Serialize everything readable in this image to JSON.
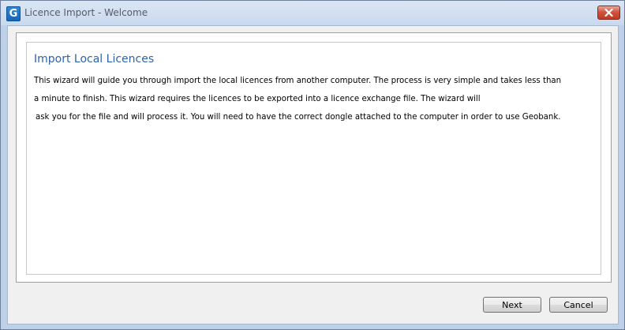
{
  "window": {
    "title": "Licence Import - Welcome",
    "app_icon_letter": "G"
  },
  "content": {
    "heading": "Import Local Licences",
    "description_lines": [
      "This wizard will guide you through import the local licences from another computer. The process is very simple and takes less than",
      "a minute to finish. This wizard requires the licences to be exported into a licence exchange file. The wizard will",
      "ask you for the file and will process it.  You will need to have the correct dongle attached to the computer in order to use Geobank."
    ]
  },
  "buttons": {
    "next_label": "Next",
    "cancel_label": "Cancel"
  },
  "colors": {
    "heading": "#2f63a8",
    "window_frame": "#bcd0e8",
    "close_button": "#c13a22"
  },
  "icons": {
    "app": "geobank-app-icon",
    "close": "close-icon"
  }
}
